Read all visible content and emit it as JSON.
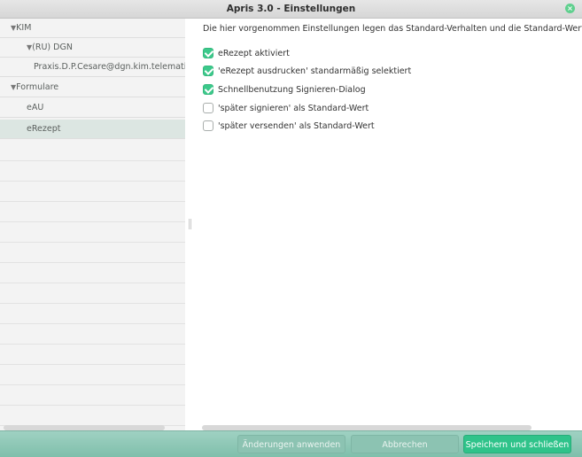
{
  "window": {
    "title": "Apris 3.0 - Einstellungen",
    "close_glyph": "⊗"
  },
  "sidebar": {
    "items": [
      {
        "label": "KIM",
        "expanded": true,
        "level": 0,
        "arrow": "▼"
      },
      {
        "label": "(RU) DGN",
        "expanded": true,
        "level": 1,
        "arrow": "▼"
      },
      {
        "label": "Praxis.D.P.Cesare@dgn.kim.telematik-te",
        "level": 2
      },
      {
        "label": "Formulare",
        "expanded": true,
        "level": 0,
        "arrow": "▼"
      },
      {
        "label": "eAU",
        "level": 1
      },
      {
        "label": "eRezept",
        "level": 1,
        "selected": true
      }
    ]
  },
  "content": {
    "description": "Die hier vorgenommen Einstellungen legen das Standard-Verhalten und die Standard-Werte für das",
    "options": [
      {
        "label": "eRezept aktiviert",
        "checked": true
      },
      {
        "label": "'eRezept ausdrucken' standarmäßig selektiert",
        "checked": true
      },
      {
        "label": "Schnellbenutzung Signieren-Dialog",
        "checked": true
      },
      {
        "label": "'später signieren' als Standard-Wert",
        "checked": false
      },
      {
        "label": "'später versenden' als Standard-Wert",
        "checked": false
      }
    ]
  },
  "footer": {
    "apply_label": "Änderungen anwenden",
    "cancel_label": "Abbrechen",
    "save_close_label": "Speichern und schließen"
  },
  "colors": {
    "accent": "#2fc38a",
    "checkbox_checked": "#3cc98b",
    "footer": "#8cc3b2",
    "selected_row": "#dce6e2"
  }
}
